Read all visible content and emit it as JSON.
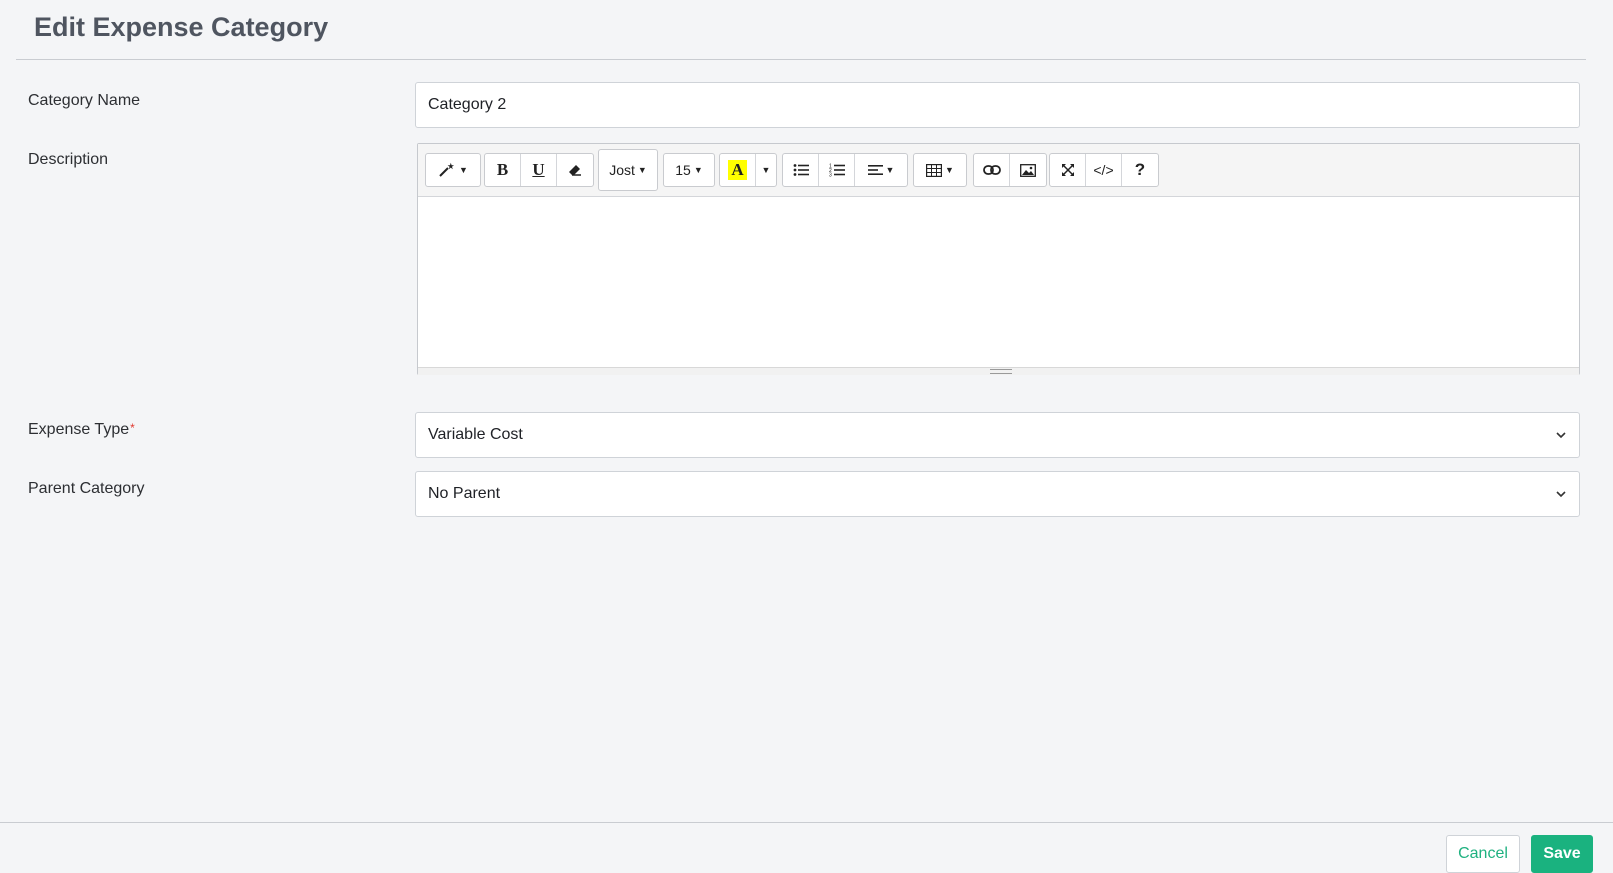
{
  "page": {
    "title": "Edit Expense Category"
  },
  "form": {
    "category_name": {
      "label": "Category Name",
      "value": "Category 2"
    },
    "description": {
      "label": "Description"
    },
    "expense_type": {
      "label": "Expense Type",
      "required_mark": "*",
      "value": "Variable Cost"
    },
    "parent_category": {
      "label": "Parent Category",
      "value": "No Parent"
    }
  },
  "toolbar": {
    "style_icon": "magic-wand-icon",
    "bold_label": "B",
    "underline_label": "U",
    "eraser_icon": "eraser-icon",
    "font_name": "Jost",
    "font_size": "15",
    "color_label": "A",
    "ul_icon": "unordered-list-icon",
    "ol_icon": "ordered-list-icon",
    "align_icon": "align-icon",
    "table_icon": "table-icon",
    "link_icon": "link-icon",
    "picture_icon": "picture-icon",
    "fullscreen_icon": "fullscreen-icon",
    "code_label": "</>",
    "help_label": "?"
  },
  "footer": {
    "cancel_label": "Cancel",
    "save_label": "Save"
  },
  "colors": {
    "accent": "#1ab27f",
    "required": "#e0382f",
    "highlight": "#ffff00"
  }
}
